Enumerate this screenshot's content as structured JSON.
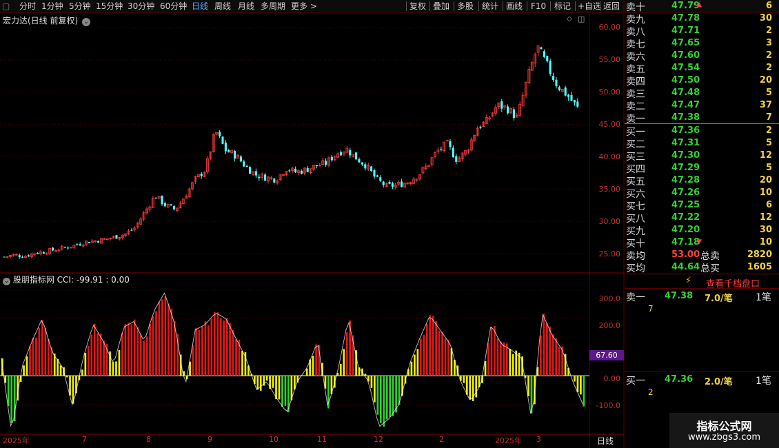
{
  "toolbar": {
    "items": [
      "分时",
      "1分钟",
      "5分钟",
      "15分钟",
      "30分钟",
      "60分钟",
      "日线",
      "周线",
      "月线",
      "多周期",
      "更多 >"
    ],
    "active_index": 6,
    "right_items": [
      "复权",
      "叠加",
      "多股",
      "统计",
      "画线",
      "F10",
      "标记",
      "+自选",
      "返回"
    ]
  },
  "chart": {
    "title": "宏力达(日线 前复权)",
    "price_ticks": [
      "60.00",
      "55.00",
      "50.00",
      "45.00",
      "40.00",
      "35.00",
      "30.00",
      "25.00"
    ],
    "indicator_name": "股朋指标网",
    "cci_label": "CCI: -99.91 : 0.00",
    "cci_ticks": [
      "300.0",
      "200.0",
      "0.00",
      "-100.0"
    ],
    "cci_marker": "67.60",
    "date_labels": [
      "2025年",
      "7",
      "8",
      "9",
      "10",
      "11",
      "12",
      "2",
      "2025年",
      "3"
    ],
    "period_label": "日线"
  },
  "chart_data": {
    "type": "candlestick",
    "title": "宏力达(日线 前复权)",
    "ylim": [
      22.5,
      62
    ],
    "close": [
      24.5,
      24.8,
      24.6,
      25.1,
      25.3,
      25.6,
      25.9,
      26.3,
      26.8,
      27.0,
      27.2,
      27.6,
      28.0,
      29.0,
      31.5,
      34.0,
      32.5,
      31.8,
      34.0,
      36.5,
      38.0,
      44.0,
      41.0,
      40.2,
      38.5,
      37.2,
      36.8,
      36.5,
      38.2,
      37.6,
      38.0,
      38.6,
      39.0,
      40.5,
      41.2,
      39.8,
      38.6,
      36.5,
      35.4,
      35.6,
      36.0,
      37.0,
      38.5,
      40.8,
      42.0,
      39.5,
      41.0,
      44.5,
      45.5,
      48.0,
      47.5,
      46.0,
      52.0,
      57.0,
      54.0,
      51.0,
      49.5,
      47.5
    ],
    "cci": [
      60,
      -200,
      30,
      120,
      200,
      80,
      30,
      -110,
      60,
      180,
      120,
      40,
      170,
      190,
      120,
      230,
      290,
      180,
      -40,
      160,
      180,
      220,
      200,
      130,
      60,
      -50,
      -20,
      -80,
      -130,
      -20,
      30,
      120,
      -110,
      20,
      200,
      30,
      -20,
      -180,
      -150,
      -100,
      40,
      130,
      210,
      160,
      110,
      -20,
      -90,
      -30,
      180,
      110,
      90,
      60,
      -160,
      220,
      140,
      90,
      -20,
      -100
    ],
    "cci_ticks": [
      300,
      200,
      0,
      -100
    ],
    "cci_ylim": [
      -200,
      350
    ],
    "date_labels": [
      "2025年",
      "7",
      "8",
      "9",
      "10",
      "11",
      "12",
      "2",
      "2025年",
      "3"
    ]
  },
  "order_book": {
    "sell": [
      {
        "label": "卖十",
        "price": "47.79",
        "vol": "6"
      },
      {
        "label": "卖九",
        "price": "47.78",
        "vol": "30"
      },
      {
        "label": "卖八",
        "price": "47.71",
        "vol": "2"
      },
      {
        "label": "卖七",
        "price": "47.65",
        "vol": "3"
      },
      {
        "label": "卖六",
        "price": "47.60",
        "vol": "2"
      },
      {
        "label": "卖五",
        "price": "47.54",
        "vol": "2"
      },
      {
        "label": "卖四",
        "price": "47.50",
        "vol": "20"
      },
      {
        "label": "卖三",
        "price": "47.48",
        "vol": "5"
      },
      {
        "label": "卖二",
        "price": "47.47",
        "vol": "37"
      },
      {
        "label": "卖一",
        "price": "47.38",
        "vol": "7"
      }
    ],
    "buy": [
      {
        "label": "买一",
        "price": "47.36",
        "vol": "2"
      },
      {
        "label": "买二",
        "price": "47.31",
        "vol": "5"
      },
      {
        "label": "买三",
        "price": "47.30",
        "vol": "12"
      },
      {
        "label": "买四",
        "price": "47.29",
        "vol": "5"
      },
      {
        "label": "买五",
        "price": "47.28",
        "vol": "20"
      },
      {
        "label": "买六",
        "price": "47.26",
        "vol": "10"
      },
      {
        "label": "买七",
        "price": "47.25",
        "vol": "6"
      },
      {
        "label": "买八",
        "price": "47.22",
        "vol": "12"
      },
      {
        "label": "买九",
        "price": "47.20",
        "vol": "30"
      },
      {
        "label": "买十",
        "price": "47.18",
        "vol": "10"
      }
    ],
    "avg_sell_label": "卖均",
    "avg_sell_price": "53.00",
    "total_sell_label": "总卖",
    "total_sell": "2820",
    "avg_buy_label": "买均",
    "avg_buy_price": "44.64",
    "total_buy_label": "总买",
    "total_buy": "1605"
  },
  "depth": {
    "view_label": "查看千档盘口",
    "sell1_label": "卖一",
    "sell1_price": "47.38",
    "sell1_per": "7.0/笔",
    "sell1_count": "1笔",
    "sell1_detail": "7",
    "buy1_label": "买一",
    "buy1_price": "47.36",
    "buy1_per": "2.0/笔",
    "buy1_count": "1笔",
    "buy1_detail": "2"
  },
  "watermark": {
    "title": "指标公式网",
    "url": "www.zbgs3.com"
  },
  "colors": {
    "up": "#ff3c3c",
    "down": "#54ffff",
    "grid": "#5a0000",
    "accent": "#59a8ff",
    "cci_red": "#e01818",
    "cci_yellow": "#f0f000",
    "cci_green": "#30d030"
  }
}
